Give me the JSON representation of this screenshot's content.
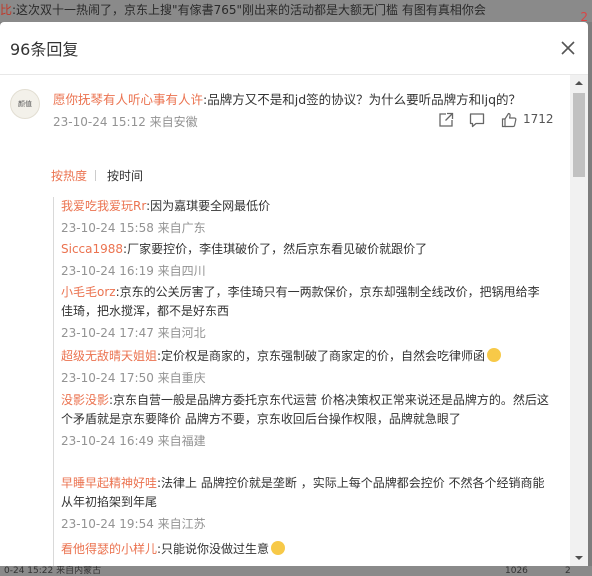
{
  "background": {
    "top_prefix": "比",
    "top_text": ":这次双十一热闹了，京东上搜\"有傢書765\"刚出来的活动都是大额无门槛 有图有真相你会",
    "side_number": "2",
    "bottom_left": "0-24 15:22 来自内蒙古",
    "bottom_count": "1026",
    "bottom_extra": "2"
  },
  "modal": {
    "title": "96条回复",
    "colors": {
      "accent": "#eb7350",
      "meta": "#939393"
    }
  },
  "main_comment": {
    "avatar_text": "颜值",
    "user": "愿你抚琴有人听心事有人许",
    "text": ":品牌方又不是和jd签的协议？为什么要听品牌方和ljq的？",
    "timestamp": "23-10-24 15:12 来自安徽",
    "likes": "1712"
  },
  "sort_tabs": [
    {
      "label": "按热度",
      "active": true
    },
    {
      "label": "按时间",
      "active": false
    }
  ],
  "replies": [
    {
      "user": "我爱吃我爱玩Rr",
      "text": ":因为嘉琪要全网最低价",
      "meta": "23-10-24 15:58 来自广东",
      "emoji": ""
    },
    {
      "user": "Sicca1988",
      "text": ":厂家要控价，李佳琪破价了，然后京东看见破价就跟价了",
      "meta": "23-10-24 16:19 来自四川",
      "emoji": ""
    },
    {
      "user": "小毛毛orz",
      "text": ":京东的公关厉害了，李佳琦只有一两款保价，京东却强制全线改价，把锅甩给李佳琦，把水搅浑，都不是好东西",
      "meta": "23-10-24 17:47 来自河北",
      "emoji": ""
    },
    {
      "user": "超级无敌晴天姐姐",
      "text": ":定价权是商家的，京东强制破了商家定的价，自然会吃律师函",
      "meta": "23-10-24 17:50 来自重庆",
      "emoji": "crying-face"
    },
    {
      "user": "没影没影",
      "text": ":京东自营一般是品牌方委托京东代运营 价格决策权正常来说还是品牌方的。然后这个矛盾就是京东要降价 品牌方不要，京东收回后台操作权限，品牌就急眼了",
      "meta": "23-10-24 16:49 来自福建",
      "emoji": ""
    },
    {
      "user": "早睡早起精神好哇",
      "text": ":法律上 品牌控价就是垄断 ，实际上每个品牌都会控价 不然各个经销商能从年初掐架到年尾",
      "meta": "23-10-24 19:54 来自江苏",
      "emoji": ""
    },
    {
      "user": "看他得瑟的小样儿",
      "text": ":只能说你没做过生意",
      "meta": "",
      "emoji": "thinking-face"
    }
  ]
}
